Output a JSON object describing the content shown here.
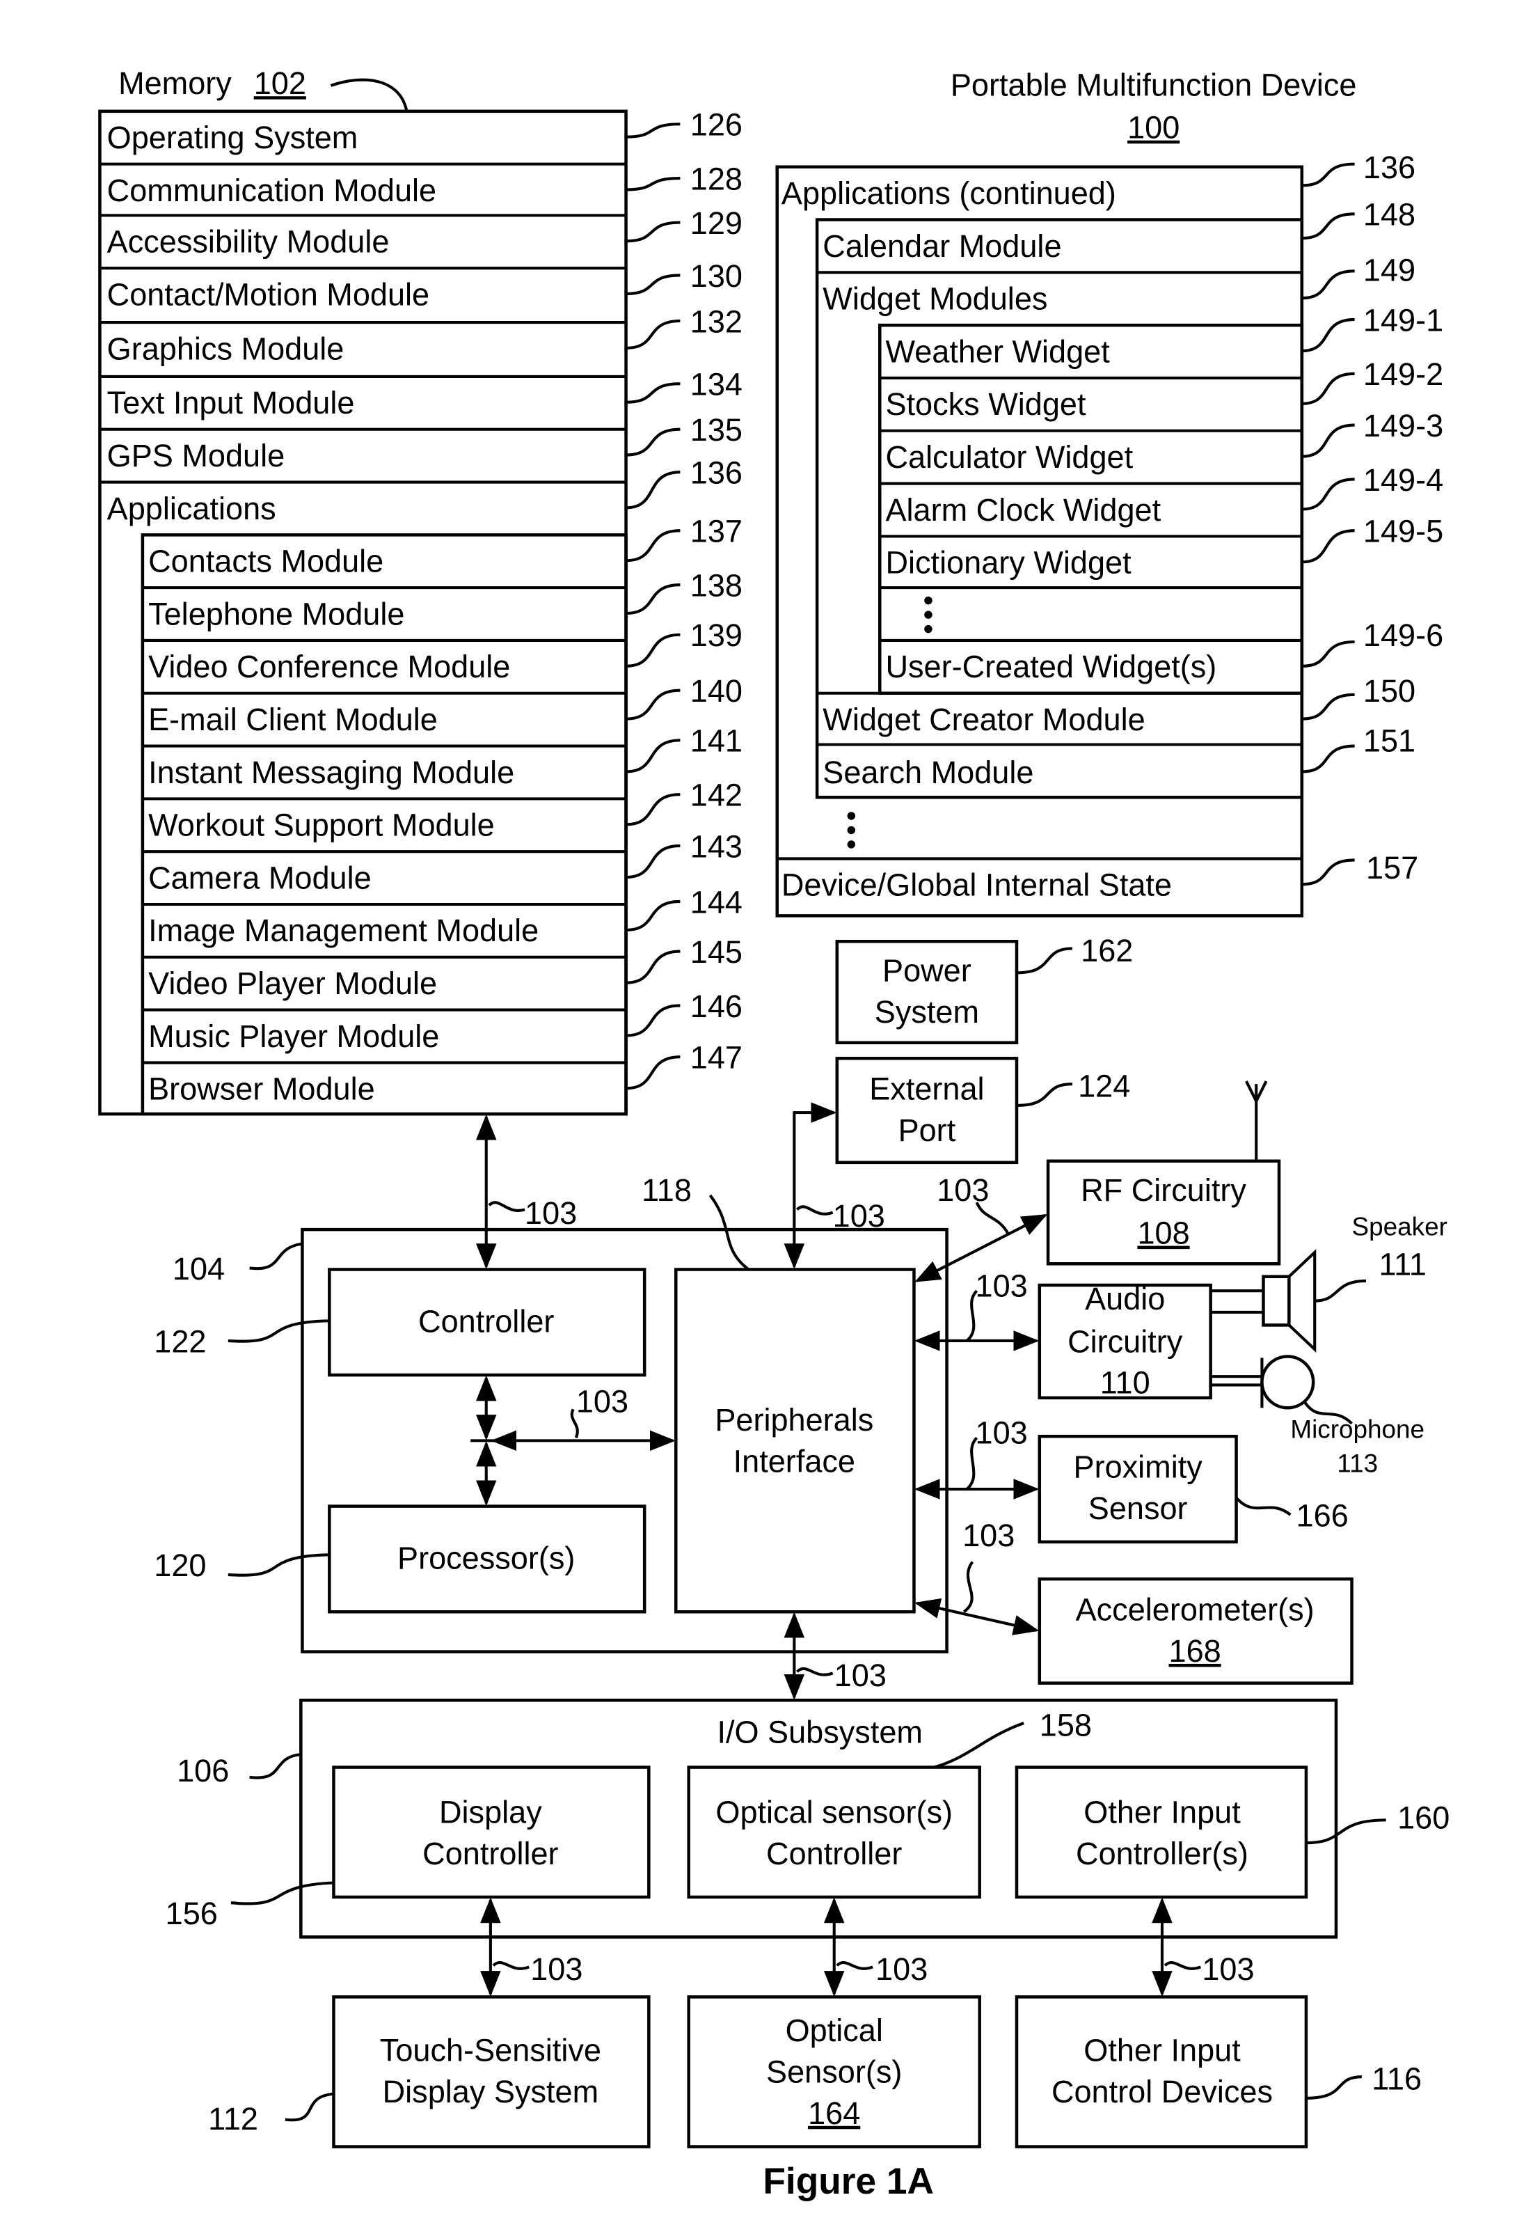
{
  "memory": {
    "title": "Memory",
    "ref": "102",
    "rows": [
      {
        "label": "Operating System",
        "ref": "126"
      },
      {
        "label": "Communication Module",
        "ref": "128"
      },
      {
        "label": "Accessibility Module",
        "ref": "129"
      },
      {
        "label": "Contact/Motion Module",
        "ref": "130"
      },
      {
        "label": "Graphics Module",
        "ref": "132"
      },
      {
        "label": "Text Input Module",
        "ref": "134"
      },
      {
        "label": "GPS Module",
        "ref": "135"
      },
      {
        "label": "Applications",
        "ref": "136"
      }
    ],
    "apps": [
      {
        "label": "Contacts Module",
        "ref": "137"
      },
      {
        "label": "Telephone Module",
        "ref": "138"
      },
      {
        "label": "Video Conference Module",
        "ref": "139"
      },
      {
        "label": "E-mail Client Module",
        "ref": "140"
      },
      {
        "label": "Instant Messaging Module",
        "ref": "141"
      },
      {
        "label": "Workout Support Module",
        "ref": "142"
      },
      {
        "label": "Camera Module",
        "ref": "143"
      },
      {
        "label": "Image Management Module",
        "ref": "144"
      },
      {
        "label": "Video Player Module",
        "ref": "145"
      },
      {
        "label": "Music Player Module",
        "ref": "146"
      },
      {
        "label": "Browser Module",
        "ref": "147"
      }
    ]
  },
  "device": {
    "title": "Portable Multifunction Device",
    "ref": "100",
    "apps_continued": {
      "label": "Applications (continued)",
      "ref": "136"
    },
    "calendar": {
      "label": "Calendar Module",
      "ref": "148"
    },
    "widget_modules": {
      "label": "Widget Modules",
      "ref": "149"
    },
    "widgets": [
      {
        "label": "Weather Widget",
        "ref": "149-1"
      },
      {
        "label": "Stocks Widget",
        "ref": "149-2"
      },
      {
        "label": "Calculator Widget",
        "ref": "149-3"
      },
      {
        "label": "Alarm Clock Widget",
        "ref": "149-4"
      },
      {
        "label": "Dictionary Widget",
        "ref": "149-5"
      }
    ],
    "user_widget": {
      "label": "User-Created Widget(s)",
      "ref": "149-6"
    },
    "widget_creator": {
      "label": "Widget Creator Module",
      "ref": "150"
    },
    "search": {
      "label": "Search Module",
      "ref": "151"
    },
    "internal_state": {
      "label": "Device/Global Internal State",
      "ref": "157"
    }
  },
  "hardware": {
    "power": {
      "line1": "Power",
      "line2": "System",
      "ref": "162"
    },
    "external_port": {
      "line1": "External",
      "line2": "Port",
      "ref": "124"
    },
    "rf": {
      "line1": "RF Circuitry",
      "num": "108"
    },
    "audio": {
      "line1": "Audio",
      "line2": "Circuitry",
      "num": "110"
    },
    "speaker": {
      "label": "Speaker",
      "ref": "111"
    },
    "microphone": {
      "label": "Microphone",
      "ref": "113"
    },
    "proximity": {
      "line1": "Proximity",
      "line2": "Sensor",
      "ref": "166"
    },
    "accelerometer": {
      "line1": "Accelerometer(s)",
      "num": "168"
    },
    "chip_ref": "104",
    "controller": {
      "label": "Controller",
      "ref": "122"
    },
    "processor": {
      "label": "Processor(s)",
      "ref": "120"
    },
    "peripherals": {
      "line1": "Peripherals",
      "line2": "Interface",
      "ref": "118"
    },
    "bus_ref": "103"
  },
  "io": {
    "title": "I/O Subsystem",
    "ref": "106",
    "display_ctrl": {
      "line1": "Display",
      "line2": "Controller",
      "ref": "156"
    },
    "optical_ctrl": {
      "line1": "Optical sensor(s)",
      "line2": "Controller",
      "ref": "158"
    },
    "other_ctrl": {
      "line1": "Other Input",
      "line2": "Controller(s)",
      "ref": "160"
    },
    "touch": {
      "line1": "Touch-Sensitive",
      "line2": "Display System",
      "ref": "112"
    },
    "optical_sensor": {
      "line1": "Optical",
      "line2": "Sensor(s)",
      "num": "164"
    },
    "other_devices": {
      "line1": "Other Input",
      "line2": "Control Devices",
      "ref": "116"
    }
  },
  "caption": "Figure 1A"
}
